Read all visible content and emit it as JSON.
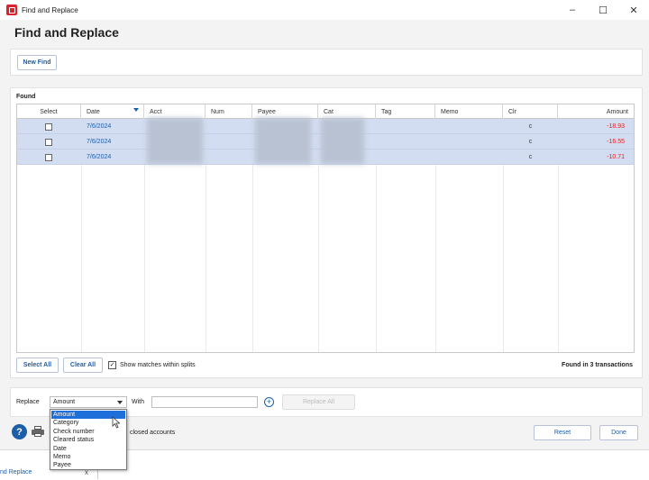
{
  "window": {
    "title": "Find and Replace",
    "controls": {
      "minimize": "–",
      "maximize": "☐",
      "close": "✕"
    }
  },
  "heading": "Find and Replace",
  "toolbar": {
    "new_find_label": "New Find"
  },
  "found": {
    "label": "Found",
    "columns": [
      "Select",
      "Date",
      "Acct",
      "Num",
      "Payee",
      "Cat",
      "Tag",
      "Memo",
      "Clr",
      "Amount"
    ],
    "rows": [
      {
        "date": "7/6/2024",
        "clr": "c",
        "amount": "-18.93"
      },
      {
        "date": "7/6/2024",
        "clr": "c",
        "amount": "-16.55"
      },
      {
        "date": "7/6/2024",
        "clr": "c",
        "amount": "-10.71"
      }
    ]
  },
  "grid_footer": {
    "select_all_label": "Select All",
    "clear_all_label": "Clear All",
    "show_splits_label": "Show matches within splits",
    "show_splits_checked": true,
    "found_count_text": "Found in 3 transactions"
  },
  "replace": {
    "replace_label": "Replace",
    "field_value": "Amount",
    "with_label": "With",
    "with_value": "",
    "replace_all_label": "Replace All",
    "options": [
      "Amount",
      "Category",
      "Check number",
      "Cleared status",
      "Date",
      "Memo",
      "Payee"
    ],
    "selected_option": "Amount"
  },
  "bottom": {
    "closed_accounts_text": "closed accounts",
    "reset_label": "Reset",
    "done_label": "Done"
  },
  "taskbar": {
    "tab_label": "nd Replace",
    "close": "x"
  },
  "colors": {
    "accent": "#1d5ea8",
    "selection_row": "#d3ddf1",
    "negative_amount": "#e02020",
    "brand": "#d9232d"
  }
}
